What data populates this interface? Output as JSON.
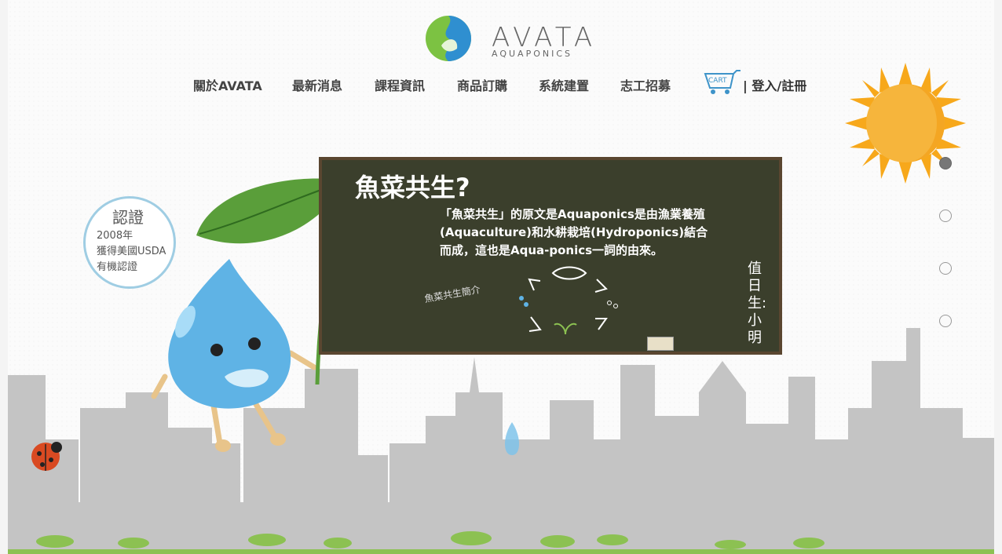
{
  "brand": {
    "name": "AVATA",
    "sub": "AQUAPONICS"
  },
  "nav": {
    "items": [
      {
        "label": "關於AVATA"
      },
      {
        "label": "最新消息"
      },
      {
        "label": "課程資訊"
      },
      {
        "label": "商品訂購"
      },
      {
        "label": "系統建置"
      },
      {
        "label": "志工招募"
      }
    ],
    "cart_label": "CART",
    "login_label": "| 登入/註冊"
  },
  "board": {
    "title": "魚菜共生?",
    "text": "「魚菜共生」的原文是Aquaponics是由漁業養殖(Aquaculture)和水耕栽培(Hydroponics)結合而成，這也是Aqua-ponics一詞的由來。",
    "side": "值日生:小明",
    "intro": "魚菜共生簡介"
  },
  "bubble": {
    "title": "認證",
    "line1": "2008年",
    "line2": "獲得美國USDA",
    "line3": "有機認證"
  },
  "colors": {
    "accent": "#3e94c9",
    "board": "#3b3f2c",
    "frame": "#5a4630",
    "city": "#c4c4c4",
    "grass": "#8cc152"
  }
}
